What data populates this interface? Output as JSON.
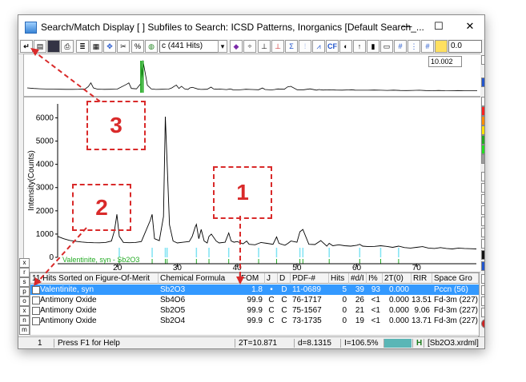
{
  "window": {
    "title": "Search/Match Display [ ] Subfiles to Search: ICSD Patterns, Inorganics [Default Search_...",
    "minimize_glyph": "—",
    "maximize_glyph": "☐",
    "close_glyph": "✕"
  },
  "toolbar": {
    "hits_combo": "c (441 Hits)",
    "zoom_value": "0.0",
    "buttons": [
      "enter-icon",
      "print-preview-icon",
      "save-icon",
      "print-icon",
      "table-icon",
      "chip-icon",
      "crosshair-icon",
      "scissors-icon",
      "percent-icon",
      "globe-icon",
      "diamond-icon",
      "axis-icon",
      "tick-icon",
      "peak-icon",
      "cf-icon",
      "circle-icon",
      "cursor-icon",
      "bar-icon",
      "list-icon",
      "hash-icon"
    ],
    "cf_label": "CF"
  },
  "overview": {
    "readout": "10.002"
  },
  "plot": {
    "ylabel": "Intensity(Counts)",
    "phase_label": "Valentinite, syn - Sb2O3"
  },
  "chart_data": {
    "type": "line",
    "title": "",
    "xlabel": "",
    "ylabel": "Intensity(Counts)",
    "xlim": [
      10.0,
      80.0
    ],
    "ylim": [
      0,
      6600
    ],
    "x_ticks": [
      20,
      30,
      40,
      50,
      60,
      70
    ],
    "y_ticks": [
      0,
      1000,
      2000,
      3000,
      4000,
      5000,
      6000
    ],
    "series": [
      {
        "x": [
          10.0,
          11,
          12,
          13,
          14,
          15,
          16,
          17,
          18,
          19,
          19.5,
          19.9,
          20.3,
          21,
          22,
          23,
          24,
          25.5,
          25.8,
          26.2,
          27,
          27.7,
          28.0,
          28.3,
          28.7,
          29.3,
          30,
          31,
          32,
          32.5,
          33,
          33.2,
          33.6,
          34,
          34.5,
          35,
          35.3,
          35.7,
          36.5,
          37,
          38,
          38.6,
          39,
          39.5,
          40,
          41,
          41.6,
          42,
          43,
          43.6,
          44,
          45,
          46,
          46.6,
          47,
          48,
          48.5,
          49,
          50,
          50.5,
          51,
          52,
          53,
          54,
          55,
          55.4,
          56,
          57,
          58,
          59,
          60,
          60.5,
          61,
          62,
          63,
          64,
          65,
          66,
          67,
          68,
          69,
          70,
          71,
          72,
          73,
          74,
          75,
          76,
          77,
          78,
          79,
          80
        ],
        "y": [
          900,
          800,
          730,
          690,
          660,
          640,
          630,
          625,
          640,
          700,
          1150,
          1850,
          900,
          640,
          630,
          640,
          680,
          1600,
          1850,
          800,
          720,
          1750,
          6050,
          4100,
          1400,
          700,
          620,
          650,
          680,
          900,
          1300,
          1420,
          800,
          1200,
          700,
          620,
          900,
          1000,
          700,
          620,
          650,
          1050,
          700,
          650,
          680,
          580,
          700,
          560,
          540,
          600,
          640,
          600,
          560,
          880,
          600,
          520,
          600,
          700,
          650,
          1100,
          1200,
          560,
          550,
          720,
          480,
          600,
          500,
          540,
          500,
          480,
          520,
          560,
          480,
          460,
          470,
          500,
          470,
          430,
          480,
          420,
          400,
          430,
          460,
          400,
          380,
          420,
          380,
          360,
          400,
          380,
          370,
          360
        ]
      }
    ],
    "reference_peaks_2theta": [
      20.3,
      25.8,
      28.0,
      28.3,
      33.2,
      35.3,
      38.6,
      43.6,
      46.6,
      50.5,
      51,
      55.4,
      60.5,
      64,
      67
    ]
  },
  "list": {
    "columns": [
      "11 Hits Sorted on Figure-Of-Merit",
      "Chemical Formula",
      "FOM",
      "J",
      "D",
      "PDF-#",
      "Hits",
      "#d/I",
      "I%",
      "2T(0)",
      "RIR",
      "Space Gro"
    ],
    "rows": [
      {
        "name": "Valentinite, syn",
        "formula": "Sb2O3",
        "fom": "1.8",
        "j": "•",
        "d": "D",
        "pdf": "11-0689",
        "hits": "5",
        "di": "39",
        "ipct": "93",
        "t0": "0.000",
        "rir": "",
        "sg": "Pccn (56)",
        "selected": true
      },
      {
        "name": "Antimony Oxide",
        "formula": "Sb4O6",
        "fom": "99.9",
        "j": "C",
        "d": "C",
        "pdf": "76-1717",
        "hits": "0",
        "di": "26",
        "ipct": "<1",
        "t0": "0.000",
        "rir": "13.51",
        "sg": "Fd-3m (227)",
        "selected": false
      },
      {
        "name": "Antimony Oxide",
        "formula": "Sb2O5",
        "fom": "99.9",
        "j": "C",
        "d": "C",
        "pdf": "75-1567",
        "hits": "0",
        "di": "21",
        "ipct": "<1",
        "t0": "0.000",
        "rir": "9.06",
        "sg": "Fd-3m (227)",
        "selected": false
      },
      {
        "name": "Antimony Oxide",
        "formula": "Sb2O4",
        "fom": "99.9",
        "j": "C",
        "d": "C",
        "pdf": "73-1735",
        "hits": "0",
        "di": "19",
        "ipct": "<1",
        "t0": "0.000",
        "rir": "13.71",
        "sg": "Fd-3m (227)",
        "selected": false
      }
    ]
  },
  "left_tabs": [
    "x",
    "r",
    "s",
    "p",
    "o",
    "x",
    "n",
    "m",
    "v"
  ],
  "status": {
    "page": "1",
    "help": "Press F1 for Help",
    "two_theta": "2T=10.871",
    "d": "d=8.1315",
    "intensity": "I=106.5%",
    "h_label": "H",
    "file": "[Sb2O3.xrdml]"
  },
  "callouts": [
    "1",
    "2",
    "3"
  ],
  "colors": {
    "callout": "#d92a2a",
    "selection": "#3399ff",
    "pattern_line": "#000000",
    "peak_green": "#22aa22",
    "stick_cyan": "#7fe3f3"
  }
}
